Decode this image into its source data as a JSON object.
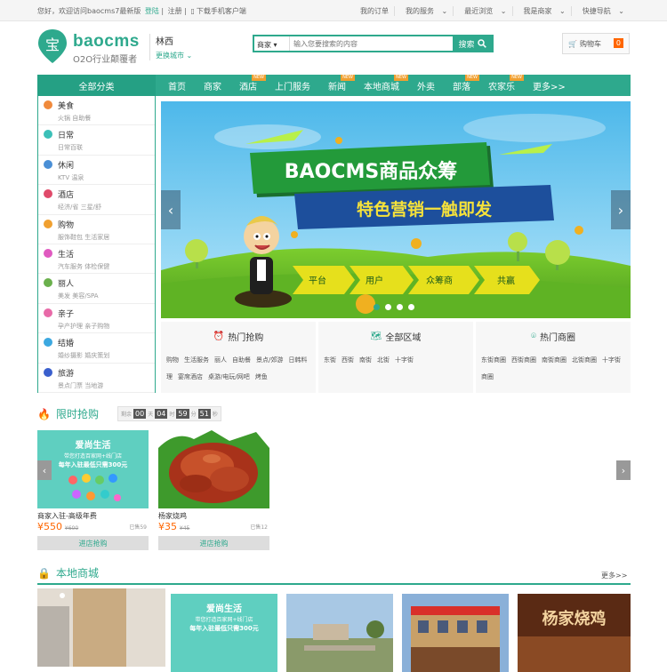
{
  "topbar": {
    "welcome": "您好，欢迎访问baocms7最新版",
    "login": "登陆",
    "register": "注册",
    "mobile": "下载手机客户端",
    "links": [
      "我的订单",
      "我的服务",
      "最近浏览",
      "我是商家",
      "快捷导航"
    ]
  },
  "header": {
    "logo_char": "宝",
    "logo_text": "baocms",
    "slogan": "O2O行业颠覆者",
    "city": "林西",
    "city_switch": "更换城市",
    "search_type": "商家",
    "search_placeholder": "输入您要搜索的内容",
    "search_button": "搜索",
    "cart_label": "购物车",
    "cart_count": "0"
  },
  "nav": {
    "all_categories": "全部分类",
    "items": [
      {
        "label": "首页",
        "new": false
      },
      {
        "label": "商家",
        "new": false
      },
      {
        "label": "酒店",
        "new": true
      },
      {
        "label": "上门服务",
        "new": false
      },
      {
        "label": "新闻",
        "new": true
      },
      {
        "label": "本地商城",
        "new": true
      },
      {
        "label": "外卖",
        "new": false
      },
      {
        "label": "部落",
        "new": true
      },
      {
        "label": "农家乐",
        "new": true
      },
      {
        "label": "更多>>",
        "new": false
      }
    ],
    "new_badge": "NEW"
  },
  "sidebar": [
    {
      "title": "美食",
      "sub": "火锅  自助餐",
      "color": "#f08a3c"
    },
    {
      "title": "日常",
      "sub": "日常百联",
      "color": "#3cc0b8"
    },
    {
      "title": "休闲",
      "sub": "KTV  温泉",
      "color": "#4a8fd6"
    },
    {
      "title": "酒店",
      "sub": "经济/省  三星/舒",
      "color": "#e04a6a"
    },
    {
      "title": "购物",
      "sub": "服饰鞋包  生活家居",
      "color": "#f0a030"
    },
    {
      "title": "生活",
      "sub": "汽车服务  体检保健",
      "color": "#e05ac0"
    },
    {
      "title": "丽人",
      "sub": "美发  美容/SPA",
      "color": "#6ab04c"
    },
    {
      "title": "亲子",
      "sub": "孕产护理  亲子购物",
      "color": "#e86aa8"
    },
    {
      "title": "结婚",
      "sub": "婚纱摄影  婚庆策划",
      "color": "#3ca8e0"
    },
    {
      "title": "旅游",
      "sub": "景点门票  当地游",
      "color": "#3a5fcd"
    }
  ],
  "banner": {
    "title": "BAOCMS商品众筹",
    "subtitle": "特色营销一触即发",
    "arrows": [
      "平台",
      "用户",
      "众筹商",
      "共赢"
    ]
  },
  "info_boxes": [
    {
      "title": "热门抢购",
      "links": [
        "购物",
        "生活服务",
        "丽人",
        "自助餐",
        "景点/郊游",
        "日韩料理",
        "宴席酒店",
        "桌游/电玩/网吧",
        "烤鱼"
      ]
    },
    {
      "title": "全部区域",
      "links": [
        "东街",
        "西街",
        "南街",
        "北街",
        "十字街"
      ]
    },
    {
      "title": "热门商圈",
      "links": [
        "东街商圈",
        "西街商圈",
        "南街商圈",
        "北街商圈",
        "十字街商圈"
      ]
    }
  ],
  "flash_sale": {
    "title": "限时抢购",
    "countdown_label": "剩余",
    "days": "00",
    "day_unit": "天",
    "hours": "04",
    "hour_unit": "时",
    "minutes": "59",
    "minute_unit": "分",
    "seconds": "51",
    "second_unit": "秒",
    "items": [
      {
        "name": "商家入驻-高级年费",
        "price": "¥550",
        "old": "¥600",
        "sold": "已售59",
        "buy": "进店抢购",
        "promo1": "爱尚生活",
        "promo2": "带您打造百家网+线门店",
        "promo3": "每年入驻最低只需300元"
      },
      {
        "name": "杨家烧鸡",
        "price": "¥35",
        "old": "¥45",
        "sold": "已售12",
        "buy": "进店抢购"
      }
    ]
  },
  "local_mall": {
    "title": "本地商城",
    "more": "更多>>",
    "promo1": "爱尚生活",
    "promo2": "带您打造百家网+线门店",
    "promo3": "每年入驻最低只需300元",
    "shop_sign": "杨家烧鸡"
  }
}
